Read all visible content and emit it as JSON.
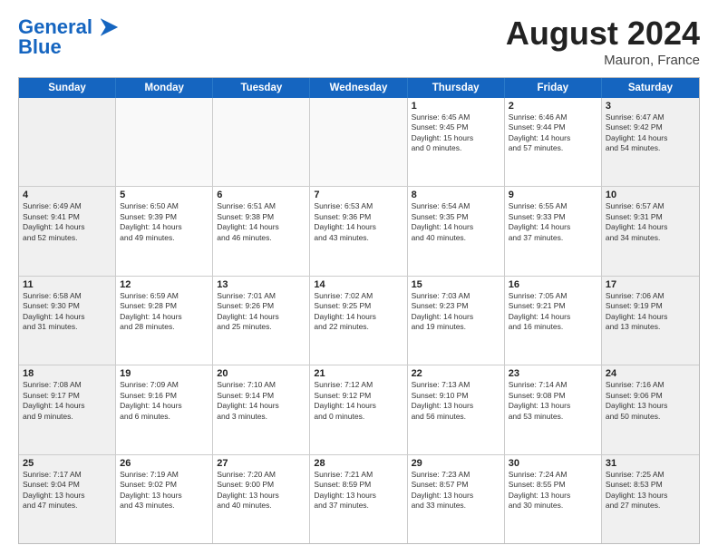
{
  "header": {
    "logo_line1": "General",
    "logo_line2": "Blue",
    "month_title": "August 2024",
    "location": "Mauron, France"
  },
  "days_of_week": [
    "Sunday",
    "Monday",
    "Tuesday",
    "Wednesday",
    "Thursday",
    "Friday",
    "Saturday"
  ],
  "weeks": [
    [
      {
        "day": "",
        "info": ""
      },
      {
        "day": "",
        "info": ""
      },
      {
        "day": "",
        "info": ""
      },
      {
        "day": "",
        "info": ""
      },
      {
        "day": "1",
        "info": "Sunrise: 6:45 AM\nSunset: 9:45 PM\nDaylight: 15 hours\nand 0 minutes."
      },
      {
        "day": "2",
        "info": "Sunrise: 6:46 AM\nSunset: 9:44 PM\nDaylight: 14 hours\nand 57 minutes."
      },
      {
        "day": "3",
        "info": "Sunrise: 6:47 AM\nSunset: 9:42 PM\nDaylight: 14 hours\nand 54 minutes."
      }
    ],
    [
      {
        "day": "4",
        "info": "Sunrise: 6:49 AM\nSunset: 9:41 PM\nDaylight: 14 hours\nand 52 minutes."
      },
      {
        "day": "5",
        "info": "Sunrise: 6:50 AM\nSunset: 9:39 PM\nDaylight: 14 hours\nand 49 minutes."
      },
      {
        "day": "6",
        "info": "Sunrise: 6:51 AM\nSunset: 9:38 PM\nDaylight: 14 hours\nand 46 minutes."
      },
      {
        "day": "7",
        "info": "Sunrise: 6:53 AM\nSunset: 9:36 PM\nDaylight: 14 hours\nand 43 minutes."
      },
      {
        "day": "8",
        "info": "Sunrise: 6:54 AM\nSunset: 9:35 PM\nDaylight: 14 hours\nand 40 minutes."
      },
      {
        "day": "9",
        "info": "Sunrise: 6:55 AM\nSunset: 9:33 PM\nDaylight: 14 hours\nand 37 minutes."
      },
      {
        "day": "10",
        "info": "Sunrise: 6:57 AM\nSunset: 9:31 PM\nDaylight: 14 hours\nand 34 minutes."
      }
    ],
    [
      {
        "day": "11",
        "info": "Sunrise: 6:58 AM\nSunset: 9:30 PM\nDaylight: 14 hours\nand 31 minutes."
      },
      {
        "day": "12",
        "info": "Sunrise: 6:59 AM\nSunset: 9:28 PM\nDaylight: 14 hours\nand 28 minutes."
      },
      {
        "day": "13",
        "info": "Sunrise: 7:01 AM\nSunset: 9:26 PM\nDaylight: 14 hours\nand 25 minutes."
      },
      {
        "day": "14",
        "info": "Sunrise: 7:02 AM\nSunset: 9:25 PM\nDaylight: 14 hours\nand 22 minutes."
      },
      {
        "day": "15",
        "info": "Sunrise: 7:03 AM\nSunset: 9:23 PM\nDaylight: 14 hours\nand 19 minutes."
      },
      {
        "day": "16",
        "info": "Sunrise: 7:05 AM\nSunset: 9:21 PM\nDaylight: 14 hours\nand 16 minutes."
      },
      {
        "day": "17",
        "info": "Sunrise: 7:06 AM\nSunset: 9:19 PM\nDaylight: 14 hours\nand 13 minutes."
      }
    ],
    [
      {
        "day": "18",
        "info": "Sunrise: 7:08 AM\nSunset: 9:17 PM\nDaylight: 14 hours\nand 9 minutes."
      },
      {
        "day": "19",
        "info": "Sunrise: 7:09 AM\nSunset: 9:16 PM\nDaylight: 14 hours\nand 6 minutes."
      },
      {
        "day": "20",
        "info": "Sunrise: 7:10 AM\nSunset: 9:14 PM\nDaylight: 14 hours\nand 3 minutes."
      },
      {
        "day": "21",
        "info": "Sunrise: 7:12 AM\nSunset: 9:12 PM\nDaylight: 14 hours\nand 0 minutes."
      },
      {
        "day": "22",
        "info": "Sunrise: 7:13 AM\nSunset: 9:10 PM\nDaylight: 13 hours\nand 56 minutes."
      },
      {
        "day": "23",
        "info": "Sunrise: 7:14 AM\nSunset: 9:08 PM\nDaylight: 13 hours\nand 53 minutes."
      },
      {
        "day": "24",
        "info": "Sunrise: 7:16 AM\nSunset: 9:06 PM\nDaylight: 13 hours\nand 50 minutes."
      }
    ],
    [
      {
        "day": "25",
        "info": "Sunrise: 7:17 AM\nSunset: 9:04 PM\nDaylight: 13 hours\nand 47 minutes."
      },
      {
        "day": "26",
        "info": "Sunrise: 7:19 AM\nSunset: 9:02 PM\nDaylight: 13 hours\nand 43 minutes."
      },
      {
        "day": "27",
        "info": "Sunrise: 7:20 AM\nSunset: 9:00 PM\nDaylight: 13 hours\nand 40 minutes."
      },
      {
        "day": "28",
        "info": "Sunrise: 7:21 AM\nSunset: 8:59 PM\nDaylight: 13 hours\nand 37 minutes."
      },
      {
        "day": "29",
        "info": "Sunrise: 7:23 AM\nSunset: 8:57 PM\nDaylight: 13 hours\nand 33 minutes."
      },
      {
        "day": "30",
        "info": "Sunrise: 7:24 AM\nSunset: 8:55 PM\nDaylight: 13 hours\nand 30 minutes."
      },
      {
        "day": "31",
        "info": "Sunrise: 7:25 AM\nSunset: 8:53 PM\nDaylight: 13 hours\nand 27 minutes."
      }
    ]
  ]
}
